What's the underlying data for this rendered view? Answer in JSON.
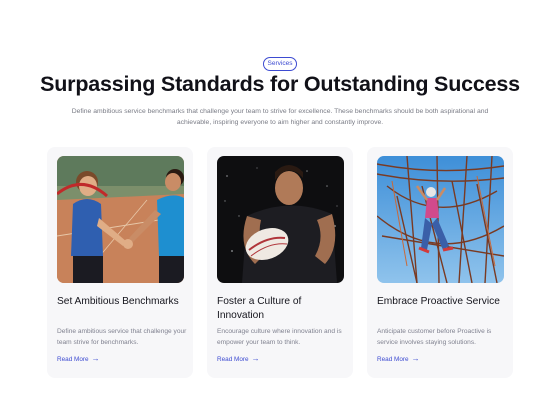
{
  "header": {
    "badge": "Services",
    "title": "Surpassing Standards for Outstanding Success",
    "subtitle": "Define ambitious service benchmarks that challenge your team to strive for excellence. These benchmarks should be both aspirational and achievable, inspiring everyone to aim higher and constantly improve."
  },
  "cards": [
    {
      "title": "Set Ambitious Benchmarks",
      "description": "Define ambitious service that challenge your team strive for benchmarks.",
      "link": "Read More",
      "image_icon": "handshake-photo"
    },
    {
      "title": "Foster a Culture of Innovation",
      "description": "Encourage culture where innovation and is empower your team to think.",
      "link": "Read More",
      "image_icon": "rugby-player-photo"
    },
    {
      "title": "Embrace Proactive Service",
      "description": "Anticipate customer before Proactive is service involves staying solutions.",
      "link": "Read More",
      "image_icon": "rope-course-photo"
    }
  ],
  "colors": {
    "accent": "#3d4bd1",
    "card_bg": "#f7f7f9",
    "text_muted": "#7a7c86"
  }
}
